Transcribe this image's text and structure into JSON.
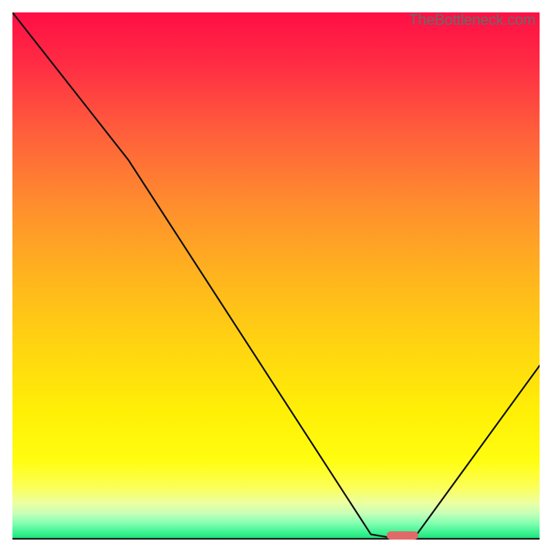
{
  "attribution": "TheBottleneck.com",
  "chart_data": {
    "type": "line",
    "title": "",
    "xlabel": "",
    "ylabel": "",
    "xlim": [
      0,
      100
    ],
    "ylim": [
      0,
      100
    ],
    "series": [
      {
        "name": "bottleneck-curve",
        "x": [
          0,
          22,
          68,
          74,
          76,
          100
        ],
        "values": [
          100,
          72,
          1,
          0,
          0,
          33
        ]
      }
    ],
    "marker": {
      "name": "optimal-range",
      "x": 74,
      "width": 6
    },
    "background_gradient": {
      "top": "#ff0e45",
      "mid": "#ffe400",
      "bottom": "#18df7a"
    }
  }
}
